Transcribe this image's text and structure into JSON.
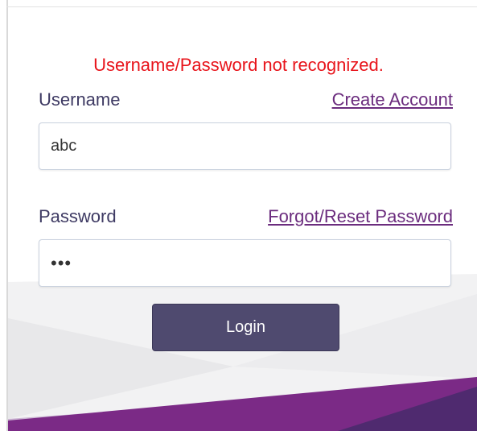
{
  "form": {
    "error_message": "Username/Password not recognized.",
    "username": {
      "label": "Username",
      "value": "abc",
      "link": "Create Account"
    },
    "password": {
      "label": "Password",
      "masked_value": "•••",
      "link": "Forgot/Reset Password"
    },
    "submit_label": "Login"
  },
  "colors": {
    "error": "#e8141b",
    "label": "#3e3a63",
    "link": "#6b2c7e",
    "button": "#4f4a6f",
    "accent_dark": "#4f2a6f",
    "accent_mid": "#7b2a86"
  }
}
